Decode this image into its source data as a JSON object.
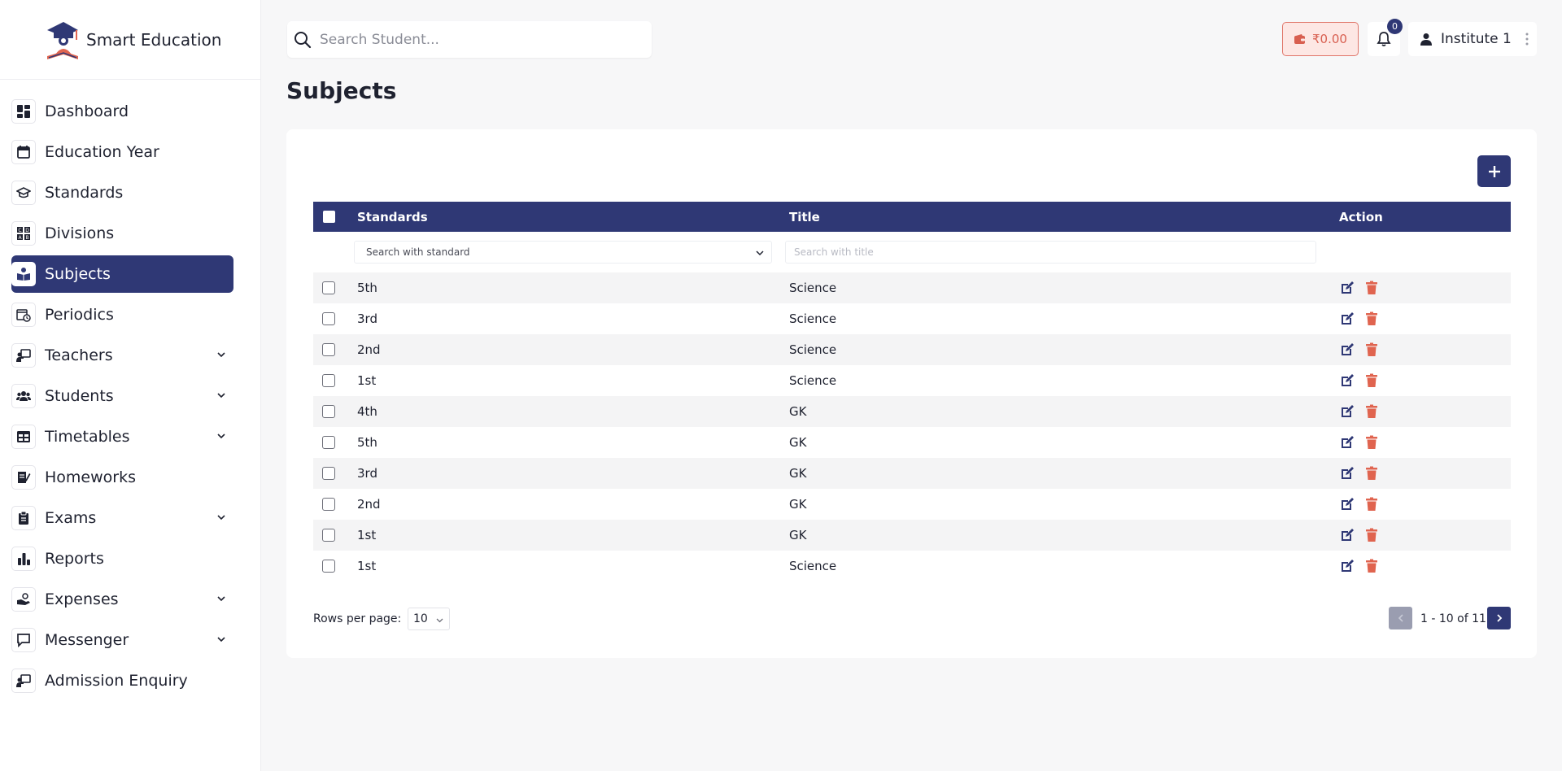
{
  "app": {
    "name": "Smart Education"
  },
  "sidebar": {
    "items": [
      {
        "label": "Dashboard",
        "icon": "dashboard-icon",
        "expandable": false,
        "active": false
      },
      {
        "label": "Education Year",
        "icon": "calendar-icon",
        "expandable": false,
        "active": false
      },
      {
        "label": "Standards",
        "icon": "graduation-cap-icon",
        "expandable": false,
        "active": false
      },
      {
        "label": "Divisions",
        "icon": "divisions-icon",
        "expandable": false,
        "active": false
      },
      {
        "label": "Subjects",
        "icon": "book-reader-icon",
        "expandable": false,
        "active": true
      },
      {
        "label": "Periodics",
        "icon": "calendar-clock-icon",
        "expandable": false,
        "active": false
      },
      {
        "label": "Teachers",
        "icon": "teacher-board-icon",
        "expandable": true,
        "active": false
      },
      {
        "label": "Students",
        "icon": "users-icon",
        "expandable": true,
        "active": false
      },
      {
        "label": "Timetables",
        "icon": "table-icon",
        "expandable": true,
        "active": false
      },
      {
        "label": "Homeworks",
        "icon": "homework-icon",
        "expandable": false,
        "active": false
      },
      {
        "label": "Exams",
        "icon": "clipboard-icon",
        "expandable": true,
        "active": false
      },
      {
        "label": "Reports",
        "icon": "bar-chart-icon",
        "expandable": false,
        "active": false
      },
      {
        "label": "Expenses",
        "icon": "hand-coin-icon",
        "expandable": true,
        "active": false
      },
      {
        "label": "Messenger",
        "icon": "message-icon",
        "expandable": true,
        "active": false
      },
      {
        "label": "Admission Enquiry",
        "icon": "teacher-board-icon",
        "expandable": false,
        "active": false
      }
    ]
  },
  "topbar": {
    "search_placeholder": "Search Student...",
    "wallet_amount": "₹0.00",
    "notification_count": "0",
    "profile_name": "Institute 1"
  },
  "page": {
    "title": "Subjects"
  },
  "table": {
    "columns": {
      "standards": "Standards",
      "title": "Title",
      "action": "Action"
    },
    "filters": {
      "standard_placeholder": "Search with standard",
      "title_placeholder": "Search with title"
    },
    "rows": [
      {
        "standard": "5th",
        "title": "Science"
      },
      {
        "standard": "3rd",
        "title": "Science"
      },
      {
        "standard": "2nd",
        "title": "Science"
      },
      {
        "standard": "1st",
        "title": "Science"
      },
      {
        "standard": "4th",
        "title": "GK"
      },
      {
        "standard": "5th",
        "title": "GK"
      },
      {
        "standard": "3rd",
        "title": "GK"
      },
      {
        "standard": "2nd",
        "title": "GK"
      },
      {
        "standard": "1st",
        "title": "GK"
      },
      {
        "standard": "1st",
        "title": "Science"
      }
    ]
  },
  "pagination": {
    "rows_per_page_label": "Rows per page:",
    "rows_per_page": "10",
    "range": "1 - 10 of 11"
  },
  "colors": {
    "primary": "#2f3875",
    "danger": "#e0644f",
    "wallet_bg": "#fde7e4"
  }
}
